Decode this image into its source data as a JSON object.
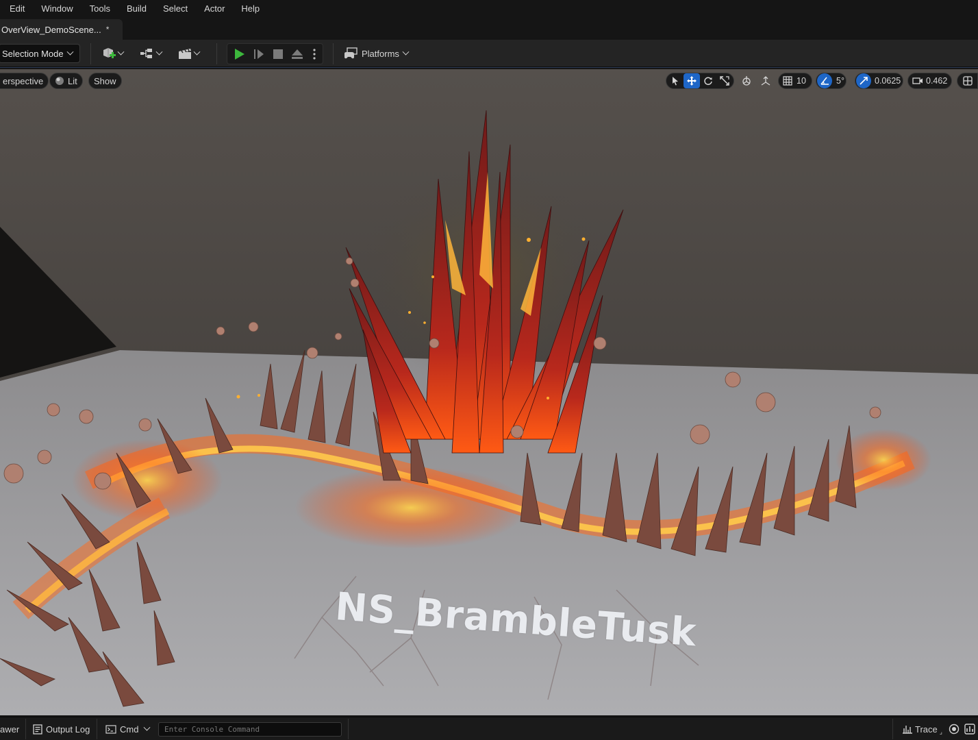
{
  "menu": [
    "Edit",
    "Window",
    "Tools",
    "Build",
    "Select",
    "Actor",
    "Help"
  ],
  "tab": {
    "title": "OverView_DemoScene...",
    "dirty_marker": "*"
  },
  "toolbar": {
    "mode_label": "Selection Mode",
    "platforms_label": "Platforms",
    "icons": [
      "add-actor-icon",
      "blueprint-icon",
      "cinematics-icon",
      "play-icon",
      "advance-frame-icon",
      "stop-icon",
      "eject-icon",
      "more-options-icon",
      "platforms-icon"
    ],
    "colors": {
      "play": "#3db83d",
      "accent": "#1e66c7"
    }
  },
  "viewport": {
    "view_mode": "erspective",
    "lighting": "Lit",
    "show_label": "Show",
    "grid_snap": "10",
    "rotation_snap": "5°",
    "scale_snap": "0.0625",
    "camera_speed": "0.462",
    "scene_label": "NS_BrambleTusk"
  },
  "statusbar": {
    "drawer_label": "awer",
    "output_log_label": "Output Log",
    "cmd_label": "Cmd",
    "console_placeholder": "Enter Console Command",
    "trace_label": "Trace"
  }
}
